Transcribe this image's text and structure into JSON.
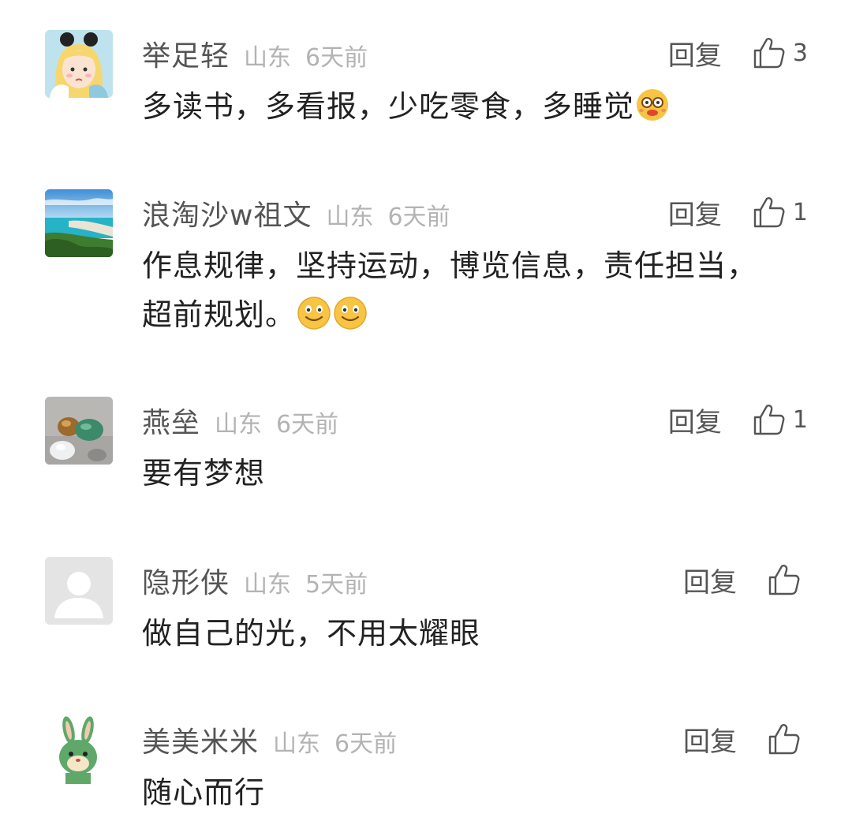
{
  "comments": [
    {
      "username": "举足轻",
      "location": "山东",
      "time": "6天前",
      "reply_label": "回复",
      "like_count": "3",
      "body": "多读书，多看报，少吃零食，多睡觉",
      "body_emojis": [
        "nerd-face-emoji"
      ],
      "avatar_icon": "cartoon-girl-avatar"
    },
    {
      "username": "浪淘沙w祖文",
      "location": "山东",
      "time": "6天前",
      "reply_label": "回复",
      "like_count": "1",
      "body_line1": "作息规律，坚持运动，博览信息，责任担当，",
      "body_line2": "超前规划。",
      "body_emojis": [
        "smiley-emoji",
        "smiley-emoji"
      ],
      "avatar_icon": "beach-landscape-avatar"
    },
    {
      "username": "燕垒",
      "location": "山东",
      "time": "6天前",
      "reply_label": "回复",
      "like_count": "1",
      "body": "要有梦想",
      "avatar_icon": "gemstones-avatar"
    },
    {
      "username": "隐形侠",
      "location": "山东",
      "time": "5天前",
      "reply_label": "回复",
      "like_count": "",
      "body": "做自己的光，不用太耀眼",
      "avatar_icon": "default-user-avatar"
    },
    {
      "username": "美美米米",
      "location": "山东",
      "time": "6天前",
      "reply_label": "回复",
      "like_count": "",
      "body": "随心而行",
      "avatar_icon": "green-rabbit-avatar"
    }
  ],
  "colors": {
    "username": "#555555",
    "meta": "#b3b3b3",
    "body": "#222222",
    "background": "#ffffff"
  },
  "icons": {
    "like": "thumbs-up-outline-icon"
  }
}
